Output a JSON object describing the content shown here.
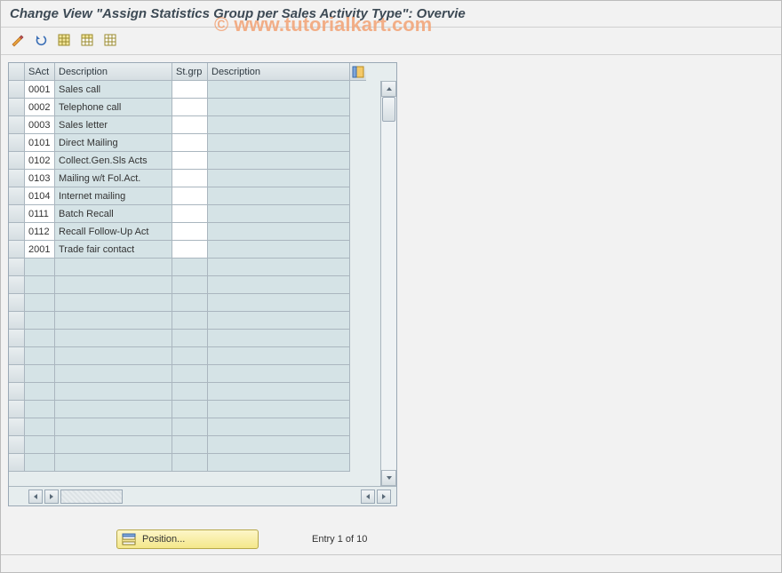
{
  "title": "Change View \"Assign Statistics Group per Sales Activity Type\": Overvie",
  "watermark": "© www.tutorialkart.com",
  "toolbar": {
    "btn1": "change-display-toggle",
    "btn2": "other-view",
    "btn3": "select-all",
    "btn4": "deselect-all",
    "btn5": "table-settings"
  },
  "columns": {
    "sact": "SAct",
    "desc1": "Description",
    "stgrp": "St.grp",
    "desc2": "Description"
  },
  "rows": [
    {
      "sact": "0001",
      "desc1": "Sales call",
      "stgrp": "",
      "desc2": ""
    },
    {
      "sact": "0002",
      "desc1": "Telephone call",
      "stgrp": "",
      "desc2": ""
    },
    {
      "sact": "0003",
      "desc1": "Sales letter",
      "stgrp": "",
      "desc2": ""
    },
    {
      "sact": "0101",
      "desc1": "Direct Mailing",
      "stgrp": "",
      "desc2": ""
    },
    {
      "sact": "0102",
      "desc1": "Collect.Gen.Sls Acts",
      "stgrp": "",
      "desc2": ""
    },
    {
      "sact": "0103",
      "desc1": "Mailing w/t Fol.Act.",
      "stgrp": "",
      "desc2": ""
    },
    {
      "sact": "0104",
      "desc1": "Internet mailing",
      "stgrp": "",
      "desc2": ""
    },
    {
      "sact": "0111",
      "desc1": "Batch Recall",
      "stgrp": "",
      "desc2": ""
    },
    {
      "sact": "0112",
      "desc1": "Recall Follow-Up Act",
      "stgrp": "",
      "desc2": ""
    },
    {
      "sact": "2001",
      "desc1": "Trade fair contact",
      "stgrp": "",
      "desc2": ""
    }
  ],
  "empty_row_count": 12,
  "position_button": {
    "label": "Position..."
  },
  "entry_indicator": "Entry 1 of 10"
}
